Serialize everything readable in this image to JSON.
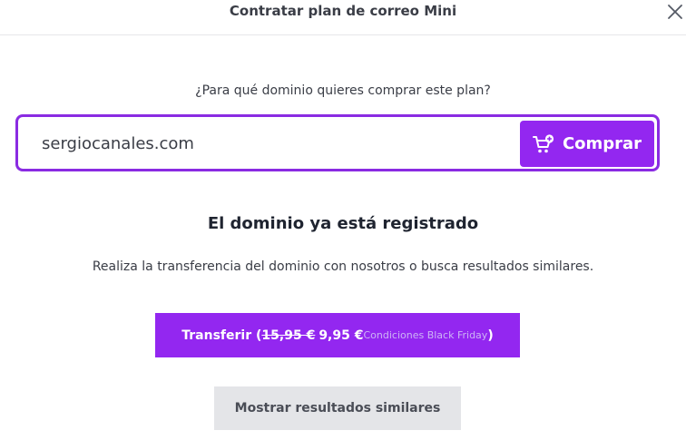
{
  "header": {
    "title": "Contratar plan de correo Mini",
    "close_icon": "close-icon"
  },
  "search": {
    "question": "¿Para qué dominio quieres comprar este plan?",
    "domain_value": "sergiocanales.com",
    "buy_label": "Comprar",
    "buy_icon": "cart-plus-icon"
  },
  "result": {
    "title": "El dominio ya está registrado",
    "description": "Realiza la transferencia del dominio con nosotros o busca resultados similares.",
    "transfer": {
      "label": "Transferir (",
      "old_price": "15,95 €",
      "new_price": "9,95 €",
      "promo": "Condiciones Black Friday",
      "close_paren": ")"
    },
    "similar_label": "Mostrar resultados similares"
  },
  "colors": {
    "accent": "#9327f0",
    "border_accent": "#8a2be2",
    "secondary_button": "#e4e5e8"
  }
}
